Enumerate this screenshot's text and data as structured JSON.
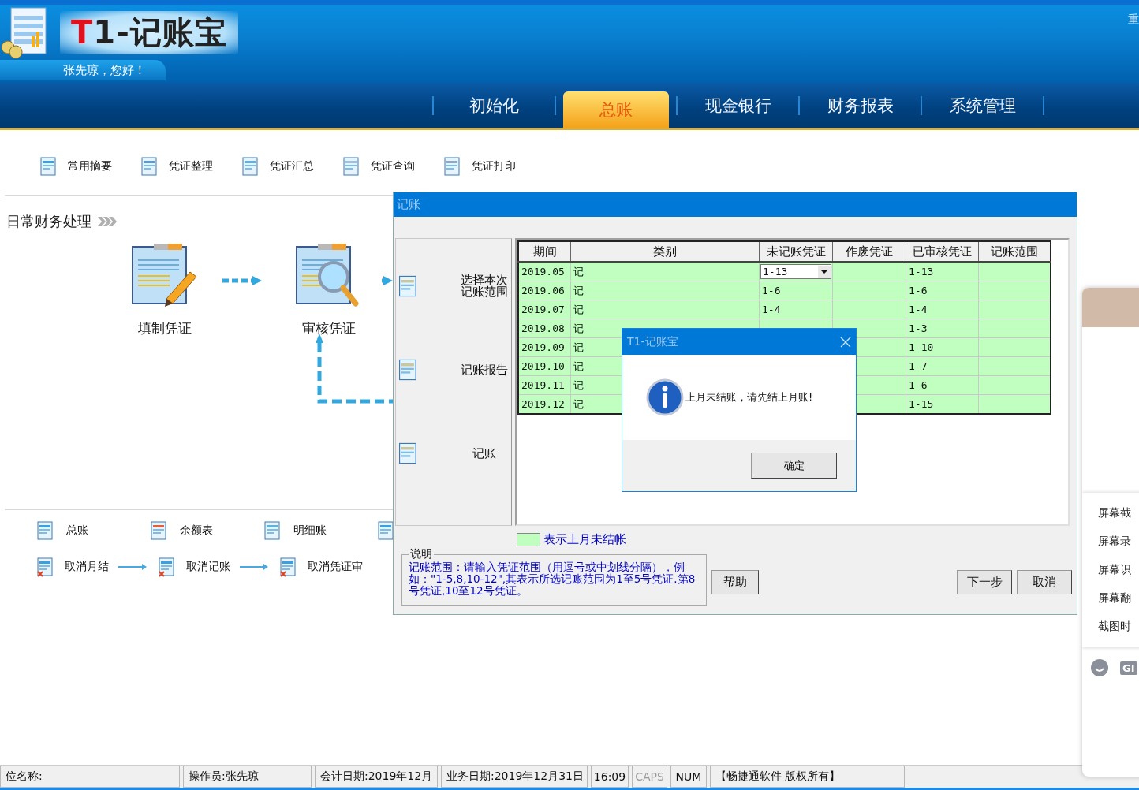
{
  "header": {
    "logo_accent": "T",
    "logo_rest": "1-记账宝",
    "greeting": "张先琼，您好！",
    "corner_text": "重"
  },
  "nav": [
    {
      "label": "初始化",
      "selected": false
    },
    {
      "label": "总账",
      "selected": true
    },
    {
      "label": "现金银行",
      "selected": false
    },
    {
      "label": "财务报表",
      "selected": false
    },
    {
      "label": "系统管理",
      "selected": false
    }
  ],
  "toolbar": [
    "常用摘要",
    "凭证整理",
    "凭证汇总",
    "凭证查询",
    "凭证打印"
  ],
  "section_title": "日常财务处理",
  "flow": [
    "填制凭证",
    "审核凭证"
  ],
  "reports": [
    "总账",
    "余额表",
    "明细账"
  ],
  "undo_chain": [
    "取消月结",
    "取消记账",
    "取消凭证审"
  ],
  "dialog": {
    "title": "记账",
    "steps": [
      "选择本次记账范围",
      "记账报告",
      "记账"
    ],
    "table": {
      "columns": [
        "期间",
        "类别",
        "未记账凭证",
        "作废凭证",
        "已审核凭证",
        "记账范围"
      ],
      "rows": [
        {
          "period": "2019.05",
          "category": "记",
          "unposted": "1-13",
          "editing": true,
          "audited": "1-13",
          "unclosed": true
        },
        {
          "period": "2019.06",
          "category": "记",
          "unposted": "1-6",
          "editing": false,
          "audited": "1-6",
          "unclosed": true
        },
        {
          "period": "2019.07",
          "category": "记",
          "unposted": "1-4",
          "editing": false,
          "audited": "1-4",
          "unclosed": true
        },
        {
          "period": "2019.08",
          "category": "记",
          "editing": false,
          "audited": "1-3",
          "unclosed": true
        },
        {
          "period": "2019.09",
          "category": "记",
          "editing": false,
          "audited": "1-10",
          "unclosed": true
        },
        {
          "period": "2019.10",
          "category": "记",
          "editing": false,
          "audited": "1-7",
          "unclosed": true
        },
        {
          "period": "2019.11",
          "category": "记",
          "editing": false,
          "audited": "1-6",
          "unclosed": true
        },
        {
          "period": "2019.12",
          "category": "记",
          "editing": false,
          "audited": "1-15",
          "unclosed": true
        }
      ]
    },
    "legend": "表示上月未结帐",
    "note": {
      "title": "说明",
      "text": "记账范围：请输入凭证范围（用逗号或中划线分隔），例如：\"1-5,8,10-12\",其表示所选记账范围为1至5号凭证.第8号凭证,10至12号凭证。"
    },
    "buttons": {
      "help": "帮助",
      "next": "下一步",
      "cancel": "取消"
    }
  },
  "message_box": {
    "title": "T1-记账宝",
    "text": "上月未结账，请先结上月账!",
    "button": "确定"
  },
  "side_panel": {
    "items": [
      "屏幕截",
      "屏幕录",
      "屏幕识",
      "屏幕翻",
      "截图时"
    ],
    "badge": "GI"
  },
  "status_bar": [
    {
      "text": "位名称:",
      "dimmed": false
    },
    {
      "text": "操作员:张先琼",
      "dimmed": false
    },
    {
      "text": "会计日期:2019年12月",
      "dimmed": false
    },
    {
      "text": "业务日期:2019年12月31日",
      "dimmed": false
    },
    {
      "text": "16:09",
      "dimmed": false
    },
    {
      "text": "CAPS",
      "dimmed": true
    },
    {
      "text": "NUM",
      "dimmed": false
    },
    {
      "text": "【畅捷通软件 版权所有】",
      "dimmed": false
    }
  ]
}
